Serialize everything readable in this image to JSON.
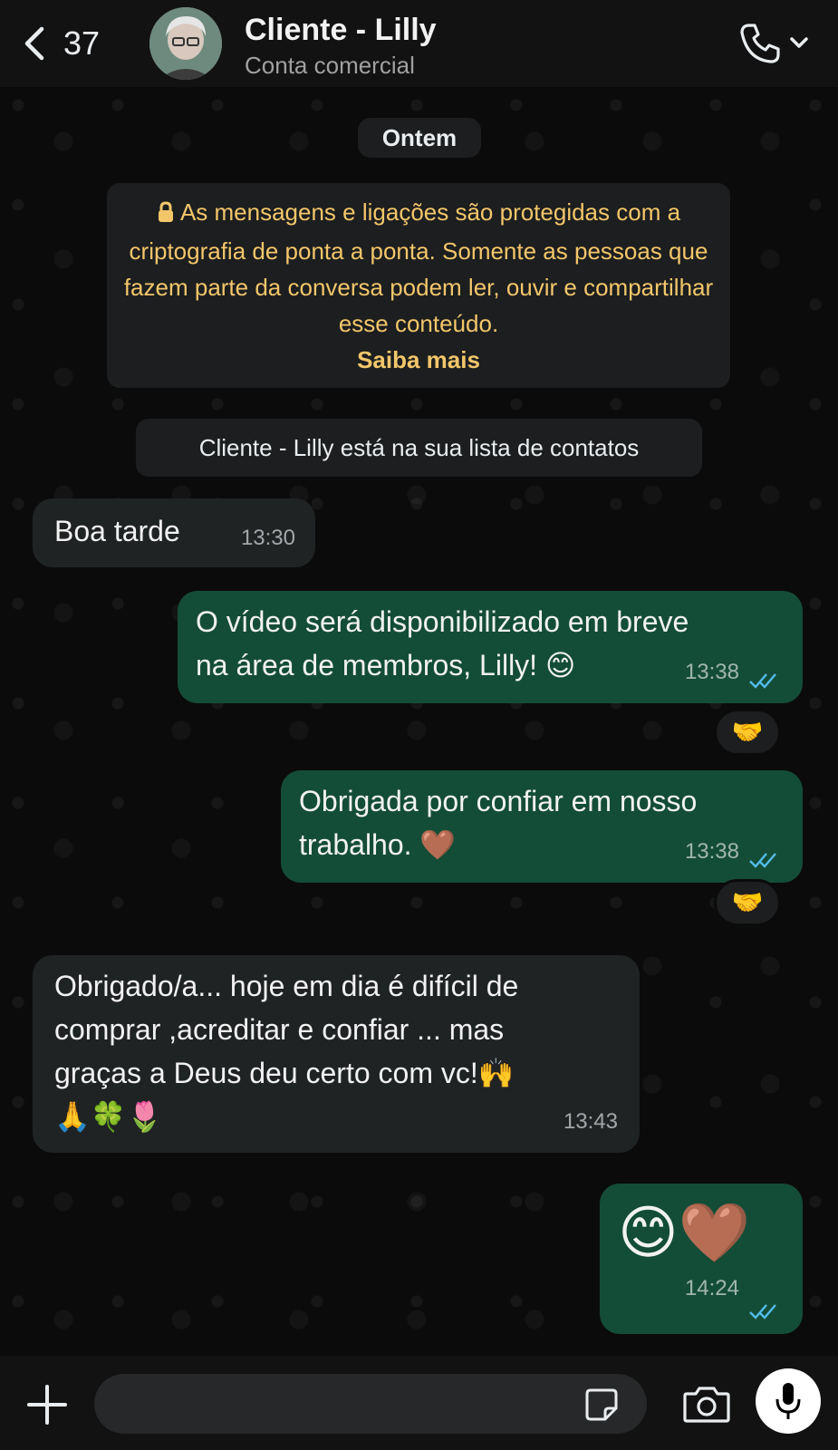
{
  "header": {
    "back_count": "37",
    "contact_name": "Cliente - Lilly",
    "contact_subtitle": "Conta comercial"
  },
  "chat": {
    "date_label": "Ontem",
    "encryption_notice": "As mensagens e ligações são protegidas com a criptografia de ponta a ponta. Somente as pessoas que fazem parte da conversa podem ler, ouvir e compartilhar esse conteúdo.",
    "encryption_link": "Saiba mais",
    "contact_notice": "Cliente - Lilly está na sua lista de contatos",
    "messages": [
      {
        "direction": "in",
        "text": "Boa tarde",
        "time": "13:30"
      },
      {
        "direction": "out",
        "text_line1": "O vídeo será disponibilizado em breve",
        "text_line2": "na área de membros, Lilly! 😊",
        "time": "13:38",
        "reaction": "🤝"
      },
      {
        "direction": "out",
        "text_line1": "Obrigada por confiar em nosso",
        "text_line2": "trabalho. 🤎",
        "time": "13:38",
        "reaction": "🤝"
      },
      {
        "direction": "in",
        "text_line1": "Obrigado/a... hoje em dia é  difícil de",
        "text_line2": "comprar ,acreditar e confiar ... mas",
        "text_line3": "graças a Deus deu certo com vc!🙌",
        "text_line4": "🙏🍀🌷",
        "time": "13:43"
      },
      {
        "direction": "out",
        "text": "😊🤎",
        "time": "14:24"
      }
    ]
  },
  "composer": {
    "placeholder": ""
  },
  "colors": {
    "incoming_bubble": "#202324",
    "outgoing_bubble": "#144d37",
    "read_ticks": "#53bdeb",
    "notice_text": "#f3c66a"
  }
}
